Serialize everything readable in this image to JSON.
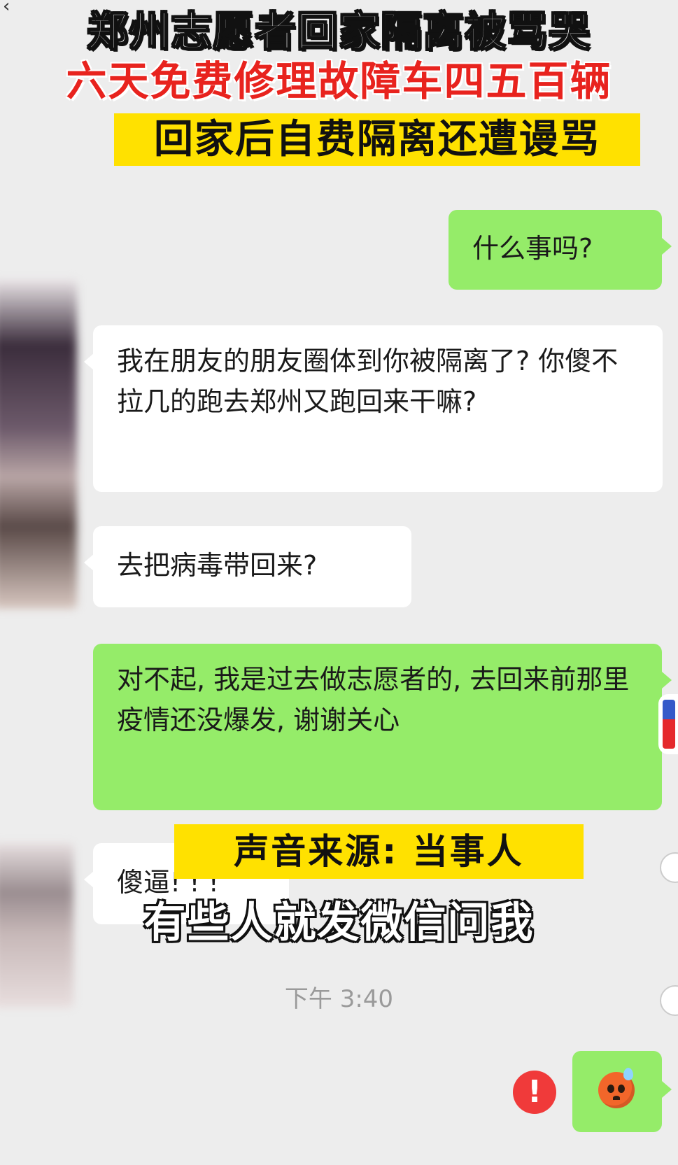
{
  "headlines": {
    "line1": "郑州志愿者回家隔离被骂哭",
    "line2": "六天免费修理故障车四五百辆",
    "line3": "回家后自费隔离还遭谩骂"
  },
  "chat": {
    "messages": [
      {
        "side": "right",
        "text": "什么事吗?"
      },
      {
        "side": "left",
        "text": "我在朋友的朋友圈体到你被隔离了? 你傻不拉几的跑去郑州又跑回来干嘛?"
      },
      {
        "side": "left",
        "text": "去把病毒带回来?"
      },
      {
        "side": "right",
        "text": "对不起, 我是过去做志愿者的, 去回来前那里疫情还没爆发, 谢谢关心"
      },
      {
        "side": "left",
        "text": "傻逼! ! !"
      }
    ],
    "timestamp": "下午 3:40",
    "last_message_emoji": "sweating-face-emoji",
    "send_failed_icon": "!"
  },
  "overlays": {
    "source_label": "声音来源: 当事人",
    "subtitle": "有些人就发微信问我"
  },
  "colors": {
    "chat_background": "#ededed",
    "outgoing_bubble": "#95ec69",
    "incoming_bubble": "#ffffff",
    "highlight_yellow": "#ffe100",
    "headline_red": "#e8231e",
    "error_red": "#f03a3a"
  }
}
